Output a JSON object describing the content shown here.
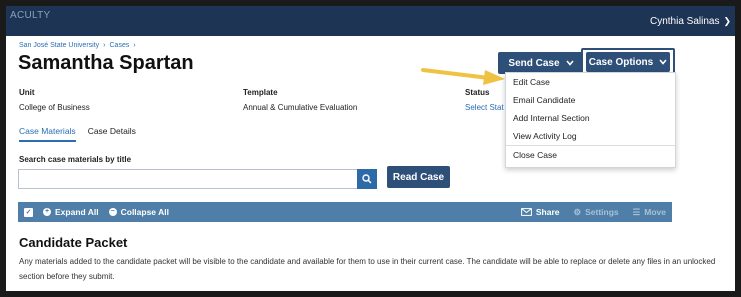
{
  "topbar": {
    "brand": "ACULTY",
    "user": "Cynthia Salinas"
  },
  "breadcrumb": [
    "San José State University",
    "Cases"
  ],
  "page_title": "Samantha Spartan",
  "buttons": {
    "send_case": "Send Case",
    "case_options": "Case Options",
    "read_case": "Read Case"
  },
  "details": {
    "unit_label": "Unit",
    "unit_value": "College of Business",
    "template_label": "Template",
    "template_value": "Annual & Cumulative Evaluation",
    "status_label": "Status",
    "status_value": "Select Stat"
  },
  "tabs": [
    "Case Materials",
    "Case Details"
  ],
  "search": {
    "label": "Search case materials by title",
    "value": "",
    "placeholder": ""
  },
  "toolbar": {
    "expand_all": "Expand All",
    "collapse_all": "Collapse All",
    "share": "Share",
    "settings": "Settings",
    "move": "Move"
  },
  "section": {
    "title": "Candidate Packet",
    "description": "Any materials added to the candidate packet will be visible to the candidate and available for them to use in their current case. The candidate will be able to replace or delete any files in an unlocked section before they submit."
  },
  "dropdown": {
    "items": [
      "Edit Case",
      "Email Candidate",
      "Add Internal Section",
      "View Activity Log",
      "Close Case"
    ]
  },
  "colors": {
    "navy": "#1d3454",
    "button": "#2d4f78",
    "toolbar": "#4f7fa8",
    "link": "#2a6db3",
    "arrow": "#f0c244"
  }
}
